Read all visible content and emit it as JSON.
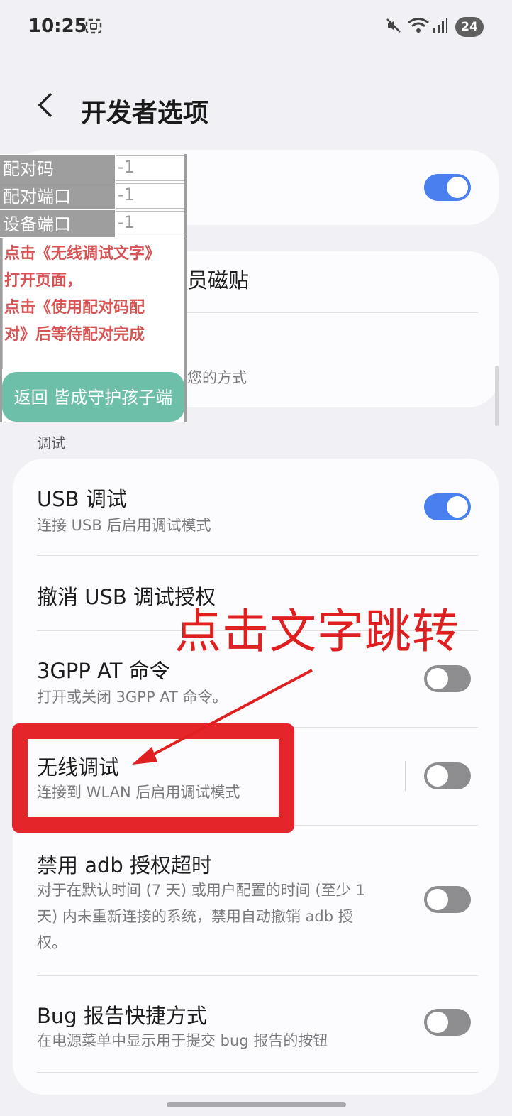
{
  "status_bar": {
    "time": "10:25",
    "battery": "24"
  },
  "header": {
    "title": "开发者选项"
  },
  "top_card": {
    "toggle_on": true
  },
  "mid_card": {
    "item1_title_visible": "员磁贴",
    "item2_sub_visible": "您的方式"
  },
  "section": {
    "debug_label": "调试"
  },
  "items": [
    {
      "title": "USB 调试",
      "subtitle": "连接 USB 后启用调试模式",
      "toggle_on": true
    },
    {
      "title": "撤消 USB 调试授权"
    },
    {
      "title": "3GPP AT 命令",
      "subtitle": "打开或关闭 3GPP AT 命令。",
      "toggle_on": false
    },
    {
      "title": "无线调试",
      "subtitle": "连接到 WLAN 后启用调试模式",
      "toggle_on": false
    },
    {
      "title": "禁用 adb 授权超时",
      "subtitle_lines": [
        "对于在默认时间 (7 天) 或用户配置的时间 (至少 1",
        "天) 内未重新连接的系统，禁用自动撤销 adb 授",
        "权。"
      ],
      "toggle_on": false
    },
    {
      "title": "Bug 报告快捷方式",
      "subtitle": "在电源菜单中显示用于提交 bug 报告的按钮",
      "toggle_on": false
    }
  ],
  "overlay": {
    "fields": [
      {
        "label": "配对码",
        "value": "-1"
      },
      {
        "label": "配对端口",
        "value": "-1"
      },
      {
        "label": "设备端口",
        "value": "-1"
      }
    ],
    "instructions": [
      "点击《无线调试文字》",
      "打开页面，",
      "点击《使用配对码配",
      "对》后等待配对完成"
    ],
    "button": "返回 皆成守护孩子端"
  },
  "annotation": {
    "text": "点击文字跳转",
    "color": "#e02020"
  },
  "colors": {
    "toggle_on": "#4a7ff0",
    "toggle_off": "#8d8d8f",
    "overlay_button": "#6dbfaa",
    "instruction_text": "#d65454"
  }
}
